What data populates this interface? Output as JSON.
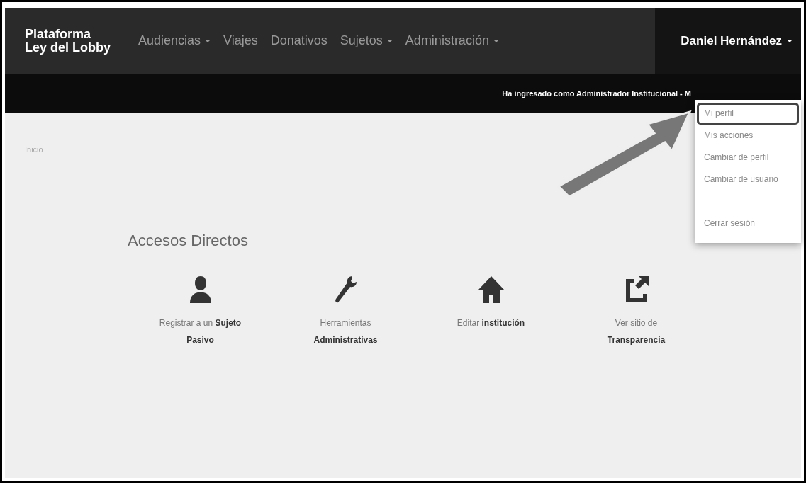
{
  "brand": {
    "line1": "Plataforma",
    "line2": "Ley del Lobby"
  },
  "nav": [
    {
      "label": "Audiencias",
      "dropdown": true
    },
    {
      "label": "Viajes",
      "dropdown": false
    },
    {
      "label": "Donativos",
      "dropdown": false
    },
    {
      "label": "Sujetos",
      "dropdown": true
    },
    {
      "label": "Administración",
      "dropdown": true
    }
  ],
  "user_menu": {
    "label": "Daniel Hernández",
    "expanded": true,
    "groups": [
      [
        {
          "label": "Mi perfil",
          "selected": true
        },
        {
          "label": "Mis acciones",
          "selected": false
        },
        {
          "label": "Cambiar de perfil",
          "selected": false
        },
        {
          "label": "Cambiar de usuario",
          "selected": false
        }
      ],
      [
        {
          "label": "Cerrar sesión",
          "selected": false
        }
      ]
    ]
  },
  "status_text": "Ha ingresado como Administrador Institucional - M",
  "breadcrumb": "Inicio",
  "shortcuts_title": "Accesos Directos",
  "shortcuts": [
    {
      "kind": "person",
      "label": "Registrar a un **Sujeto Pasivo**"
    },
    {
      "kind": "wrench",
      "label": "Herramientas **Administrativas**"
    },
    {
      "kind": "home",
      "label": "Editar **institución**"
    },
    {
      "kind": "external",
      "label": "Ver sitio de **Transparencia**"
    }
  ]
}
